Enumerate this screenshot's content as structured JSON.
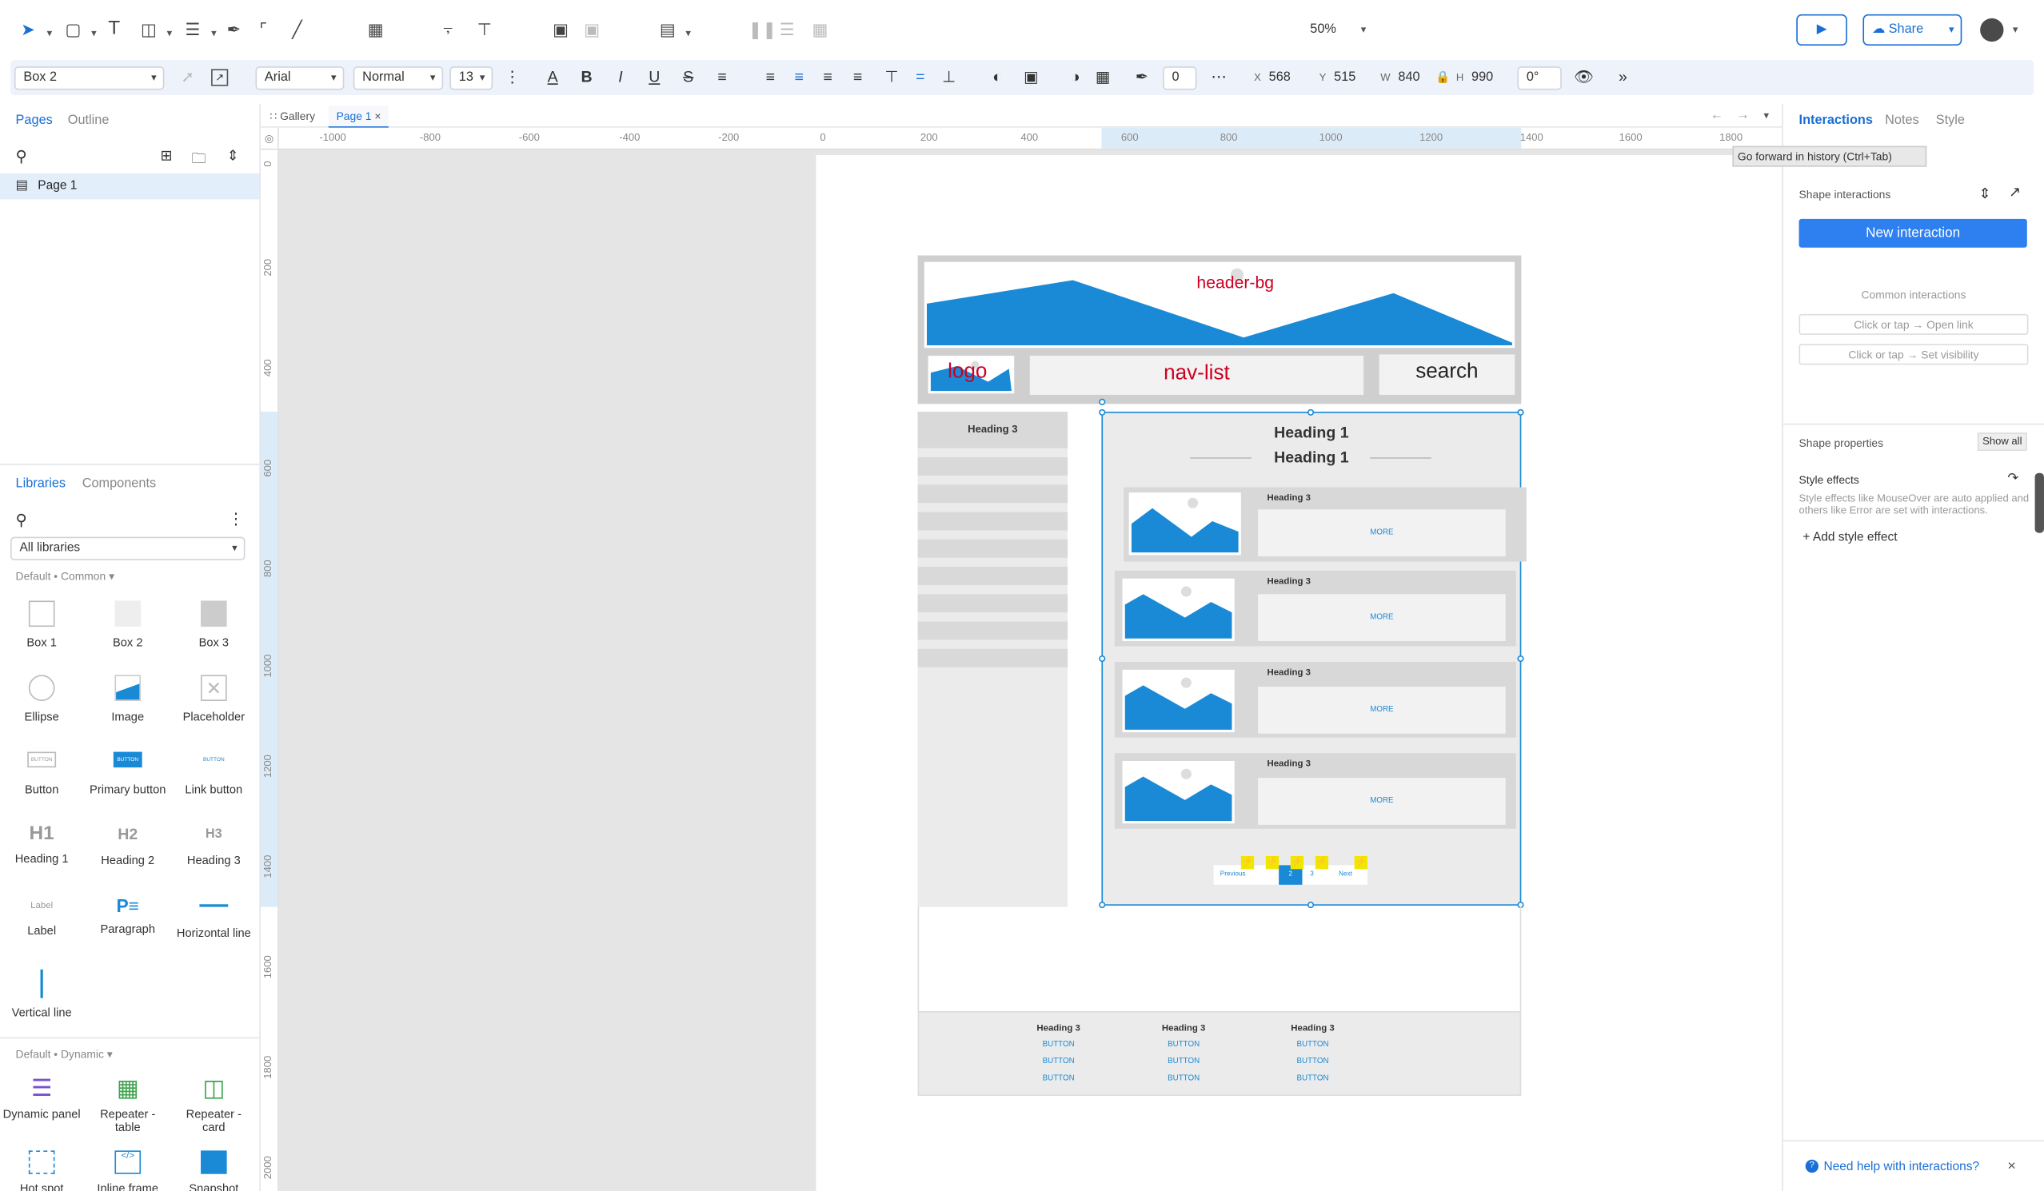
{
  "toolbar": {
    "zoom": "50%",
    "share": "Share"
  },
  "format": {
    "shape_style": "Box 2",
    "font": "Arial",
    "weight": "Normal",
    "size": "13",
    "stroke": "0",
    "x_label": "X",
    "x": "568",
    "y_label": "Y",
    "y": "515",
    "w_label": "W",
    "w": "840",
    "h_label": "H",
    "h": "990",
    "rotation": "0°"
  },
  "left": {
    "tab_pages": "Pages",
    "tab_outline": "Outline",
    "page1": "Page 1",
    "tab_libraries": "Libraries",
    "tab_components": "Components",
    "library_select": "All libraries",
    "section_common": "Default • Common ▾",
    "section_dynamic": "Default • Dynamic ▾",
    "items": [
      "Box 1",
      "Box 2",
      "Box 3",
      "Ellipse",
      "Image",
      "Placeholder",
      "Button",
      "Primary button",
      "Link button",
      "Heading 1",
      "Heading 2",
      "Heading 3",
      "Label",
      "Paragraph",
      "Horizontal line",
      "Vertical line"
    ],
    "icon_text": {
      "button": "BUTTON",
      "h1": "H1",
      "h2": "H2",
      "h3": "H3",
      "label": "Label"
    },
    "dynamic": [
      "Dynamic panel",
      "Repeater - table",
      "Repeater - card",
      "Hot spot",
      "Inline frame",
      "Snapshot"
    ]
  },
  "tabs": {
    "gallery": "Gallery",
    "page1": "Page 1"
  },
  "ruler_h": [
    "-1000",
    "-800",
    "-600",
    "-400",
    "-200",
    "0",
    "200",
    "400",
    "600",
    "800",
    "1000",
    "1200",
    "1400",
    "1600",
    "1800"
  ],
  "ruler_v": [
    "0",
    "200",
    "400",
    "600",
    "800",
    "1000",
    "1200",
    "1400",
    "1600",
    "1800",
    "2000"
  ],
  "canvas": {
    "header_bg": "header-bg",
    "logo": "logo",
    "nav": "nav-list",
    "search": "search",
    "sidebar_heading": "Heading 3",
    "heading1": "Heading 1",
    "heading1b": "Heading 1",
    "row_heading": "Heading 3",
    "more": "MORE",
    "prev": "Previous",
    "next": "Next",
    "page_active": "2",
    "page_3": "3",
    "footer_heading": "Heading 3",
    "footer_button": "BUTTON"
  },
  "right": {
    "tab_interactions": "Interactions",
    "tab_notes": "Notes",
    "tab_style": "Style",
    "tooltip": "Go forward in history (Ctrl+Tab)",
    "shape_interactions": "Shape interactions",
    "new_interaction": "New interaction",
    "common": "Common interactions",
    "common1": "Click or tap → Open link",
    "common2": "Click or tap → Set visibility",
    "shape_props": "Shape properties",
    "show_all": "Show all",
    "style_effects": "Style effects",
    "style_desc": "Style effects like MouseOver are auto applied and others like Error are set with interactions.",
    "add_style": "+ Add style effect",
    "help": "Need help with interactions?"
  }
}
